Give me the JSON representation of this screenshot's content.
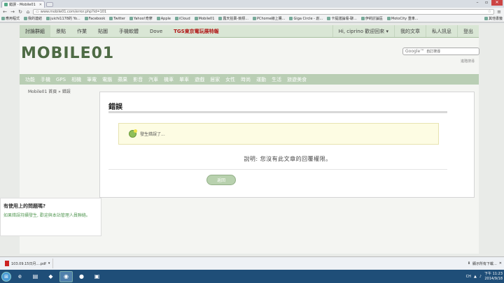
{
  "browser": {
    "tab_title": "錯誤 - Mobile01",
    "url": "www.mobile01.com/error.php?id=101",
    "bookmarks": [
      "應用程式",
      "我的連結",
      "juichi1178的 Yo...",
      "Facebook",
      "Twitter",
      "Yahoo!奇摩",
      "Apple",
      "iCloud",
      "Mobile01",
      "露天拍賣-競標...",
      "PChome線上購...",
      "Giga Circle - 創...",
      "卡提諾論壇-聊...",
      "伊莉討論區",
      "MotoCity 重車..."
    ],
    "other_bookmarks": "其他書籤"
  },
  "topnav": {
    "items": [
      "討論群組",
      "景點",
      "作業",
      "貼圖",
      "手機軟體",
      "Dove"
    ],
    "tgs": "TGS東京電玩展特報",
    "user": "Hi, ciprino 歡迎回來 ▾",
    "right": [
      "我的文章",
      "私人訊息",
      "登出"
    ]
  },
  "logo": "MOBILE01",
  "search": {
    "brand": "Google™",
    "placeholder": "自訂搜尋"
  },
  "advanced_search": "進階搜尋",
  "categories": [
    "功能",
    "手機",
    "GPS",
    "相機",
    "筆電",
    "電腦",
    "蘋果",
    "影音",
    "汽車",
    "機車",
    "單車",
    "遊戲",
    "居家",
    "女性",
    "時尚",
    "運動",
    "生活",
    "旅遊美食"
  ],
  "breadcrumb": "Mobile01 首頁 » 錯誤",
  "error": {
    "title": "錯誤",
    "message": "發生錯誤了...",
    "description": "說明: 您沒有此文章的回覆權限。",
    "back_button": "返回"
  },
  "help": {
    "title": "有使用上的問題嗎?",
    "text": "如果錯誤持續發生, 歡迎與本站管理人員聯絡。"
  },
  "download": {
    "file": "103.09.15日月....pdf",
    "show_all": "顯示所有下載..."
  },
  "taskbar": {
    "lang": "CH",
    "time": "下午 11:23",
    "date": "2014/9/18"
  }
}
